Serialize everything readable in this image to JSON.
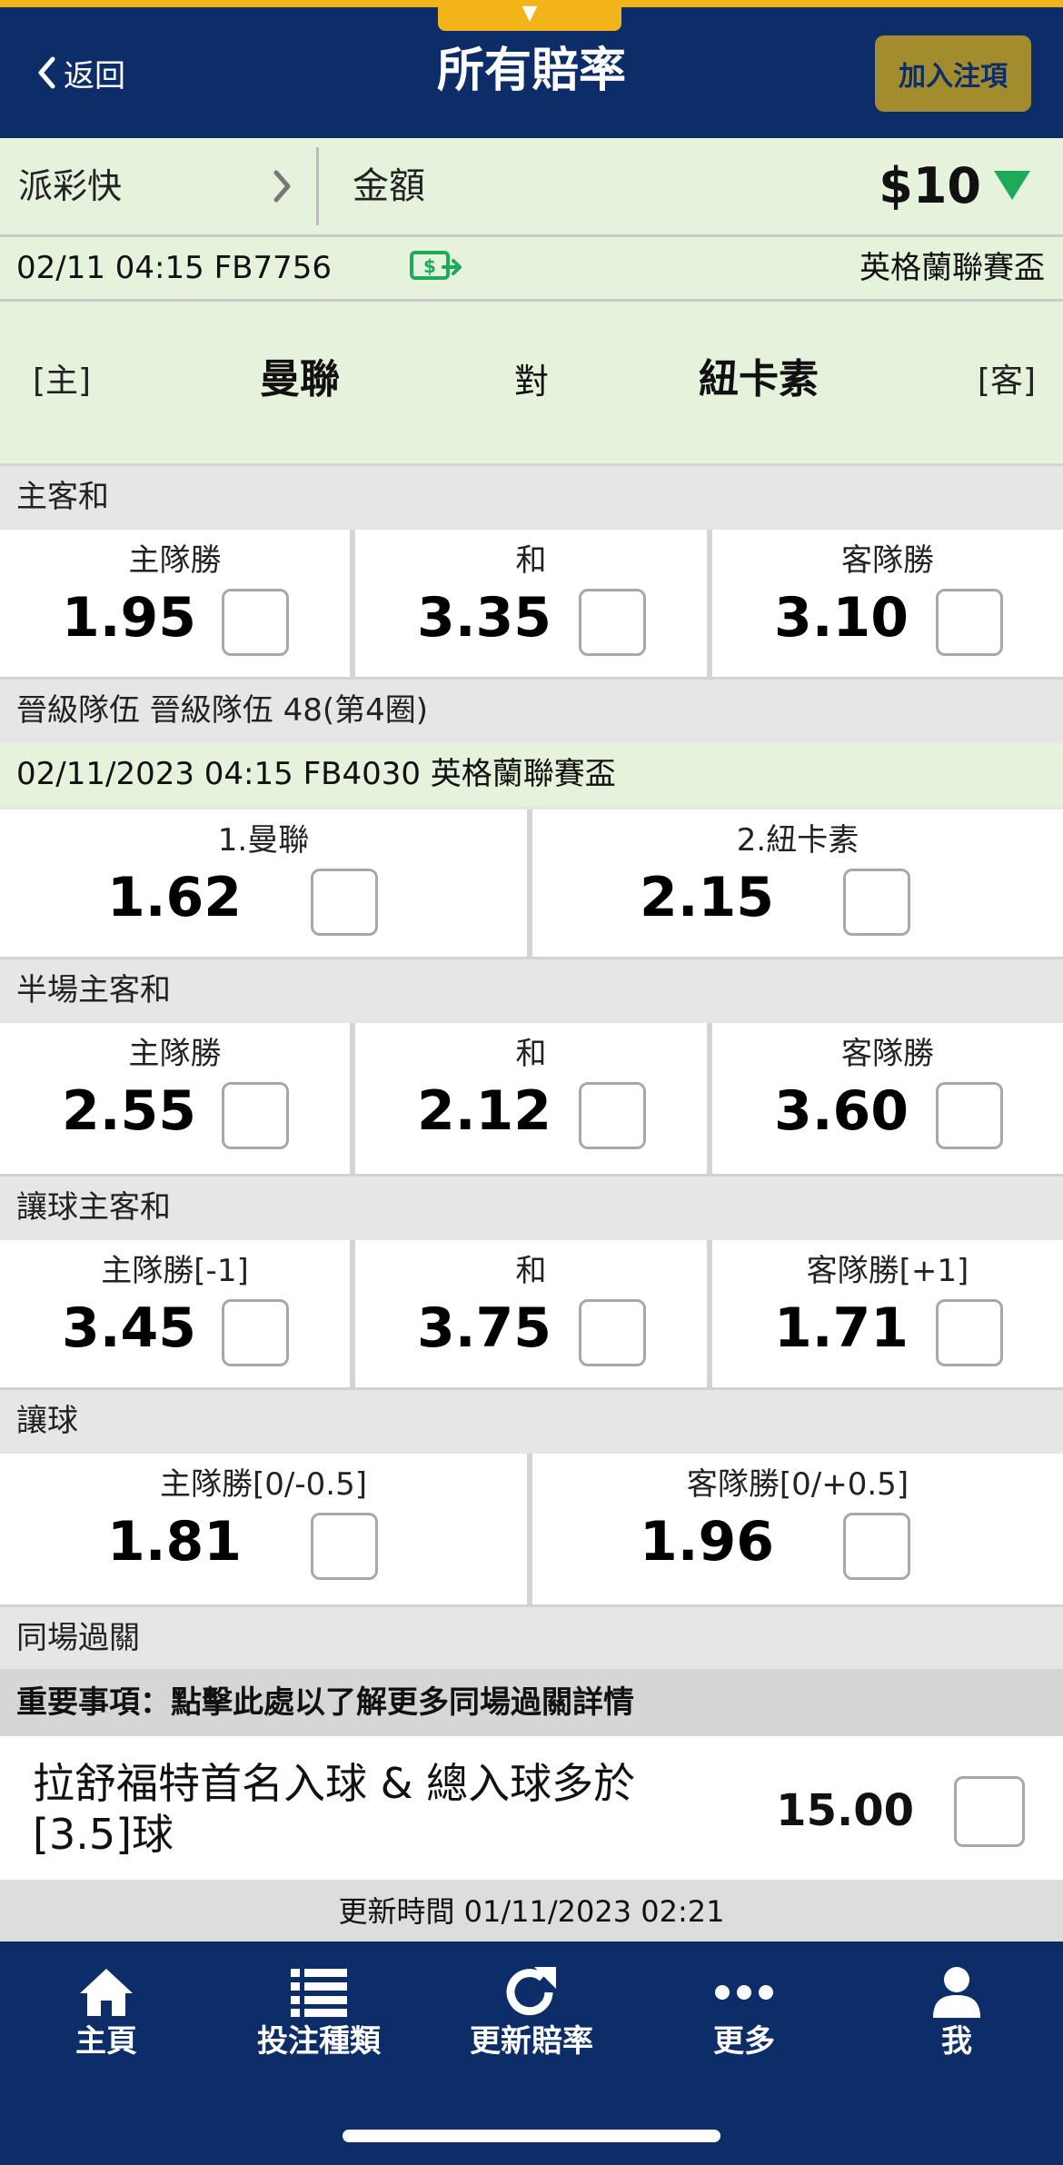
{
  "header": {
    "back_label": "返回",
    "title": "所有賠率",
    "add_bet_label": "加入注項",
    "top_tab_glyph": "▼"
  },
  "amount_bar": {
    "pai_cai_label": "派彩快",
    "amount_label": "金額",
    "amount_value": "$10"
  },
  "match": {
    "info": "02/11 04:15 FB7756",
    "league": "英格蘭聯賽盃",
    "home_tag": "[主]",
    "home_team": "曼聯",
    "vs": "對",
    "away_team": "紐卡素",
    "away_tag": "[客]"
  },
  "markets": {
    "hda": {
      "title": "主客和",
      "options": [
        {
          "label": "主隊勝",
          "odds": "1.95"
        },
        {
          "label": "和",
          "odds": "3.35"
        },
        {
          "label": "客隊勝",
          "odds": "3.10"
        }
      ]
    },
    "to_qualify": {
      "title": "晉級隊伍 晉級隊伍 48(第4圈)",
      "sub_info": "02/11/2023 04:15  FB4030  英格蘭聯賽盃",
      "options": [
        {
          "label": "1.曼聯",
          "odds": "1.62"
        },
        {
          "label": "2.紐卡素",
          "odds": "2.15"
        }
      ]
    },
    "half_time_hda": {
      "title": "半場主客和",
      "options": [
        {
          "label": "主隊勝",
          "odds": "2.55"
        },
        {
          "label": "和",
          "odds": "2.12"
        },
        {
          "label": "客隊勝",
          "odds": "3.60"
        }
      ]
    },
    "handicap_hda": {
      "title": "讓球主客和",
      "options": [
        {
          "label": "主隊勝[-1]",
          "odds": "3.45"
        },
        {
          "label": "和",
          "odds": "3.75"
        },
        {
          "label": "客隊勝[+1]",
          "odds": "1.71"
        }
      ]
    },
    "handicap": {
      "title": "讓球",
      "options": [
        {
          "label": "主隊勝[0/-0.5]",
          "odds": "1.81"
        },
        {
          "label": "客隊勝[0/+0.5]",
          "odds": "1.96"
        }
      ]
    },
    "same_game": {
      "title": "同場過關",
      "notice": "重要事項：點擊此處以了解更多同場過關詳情",
      "selection": "拉舒福特首名入球 & 總入球多於 [3.5]球",
      "odds": "15.00"
    }
  },
  "update_text": "更新時間 01/11/2023 02:21",
  "nav": {
    "items": [
      {
        "label": "主頁",
        "icon": "home-icon"
      },
      {
        "label": "投注種類",
        "icon": "list-icon"
      },
      {
        "label": "更新賠率",
        "icon": "refresh-icon"
      },
      {
        "label": "更多",
        "icon": "more-icon"
      },
      {
        "label": "我",
        "icon": "user-icon"
      }
    ]
  },
  "colors": {
    "navy": "#0d2d68",
    "gold": "#f2b418",
    "add_bet_bg": "#a28c2e",
    "light_green": "#e5f2dc",
    "caret_green": "#1faa5a"
  }
}
